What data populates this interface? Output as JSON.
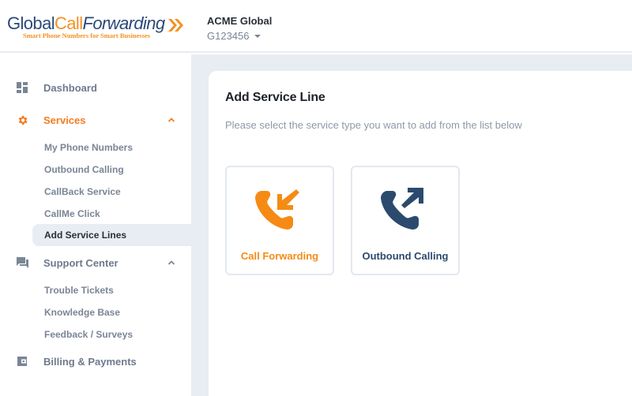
{
  "header": {
    "logo": {
      "part1": "Global",
      "part2": "Call",
      "part3": "Forwarding",
      "tagline": "Smart Phone Numbers for Smart Businesses"
    },
    "account": {
      "name": "ACME Global",
      "id": "G123456"
    }
  },
  "sidebar": {
    "items": [
      {
        "label": "Dashboard",
        "icon": "dashboard-icon"
      },
      {
        "label": "Services",
        "icon": "gear-icon",
        "expanded": true,
        "active": true,
        "children": [
          {
            "label": "My Phone Numbers"
          },
          {
            "label": "Outbound Calling"
          },
          {
            "label": "CallBack Service"
          },
          {
            "label": "CallMe Click"
          },
          {
            "label": "Add Service Lines",
            "selected": true
          }
        ]
      },
      {
        "label": "Support Center",
        "icon": "forum-icon",
        "expanded": true,
        "children": [
          {
            "label": "Trouble Tickets"
          },
          {
            "label": "Knowledge Base"
          },
          {
            "label": "Feedback / Surveys"
          }
        ]
      },
      {
        "label": "Billing & Payments",
        "icon": "wallet-icon"
      }
    ]
  },
  "main": {
    "title": "Add Service Line",
    "subtitle": "Please select the service type you want to add from the list below",
    "cards": [
      {
        "label": "Call Forwarding",
        "icon": "incoming-call-icon",
        "color": "#f58b14"
      },
      {
        "label": "Outbound Calling",
        "icon": "outgoing-call-icon",
        "color": "#2c4a6e"
      }
    ]
  },
  "colors": {
    "accent": "#f47b20",
    "brand_blue": "#2b4a7a",
    "sidebar_text": "#6e7a8c",
    "background": "#e8edf3"
  }
}
